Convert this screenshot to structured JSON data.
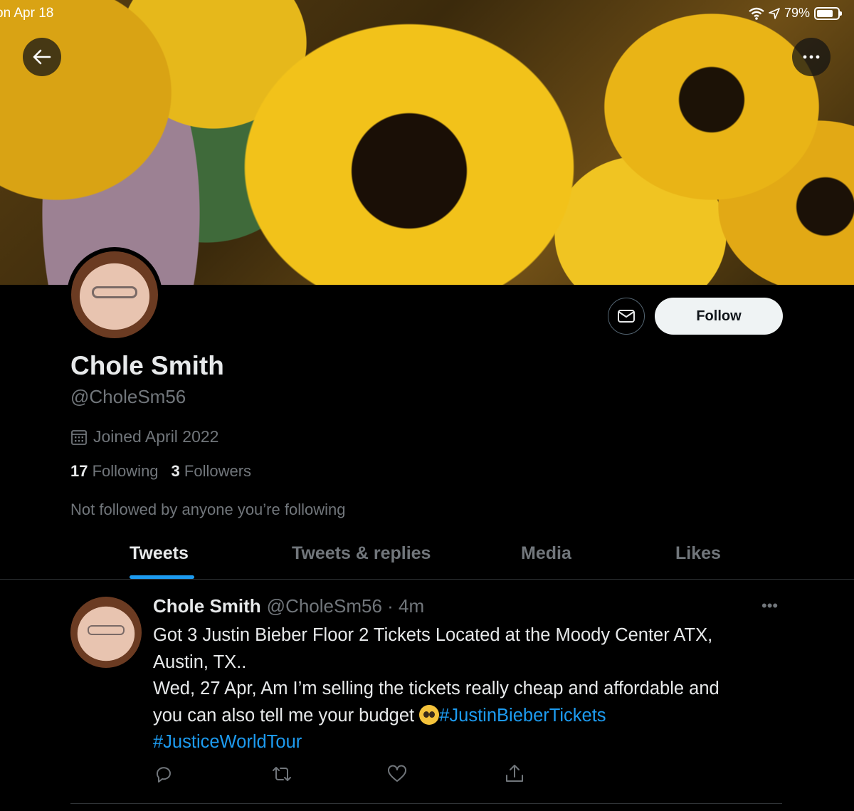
{
  "statusbar": {
    "date": "on Apr 18",
    "battery": "79%",
    "battery_level": 0.79
  },
  "profile": {
    "name": "Chole Smith",
    "handle": "@CholeSm56",
    "joined": "Joined April 2022",
    "following_count": "17",
    "following_label": "Following",
    "followers_count": "3",
    "followers_label": "Followers",
    "mutuals": "Not followed by anyone you’re following",
    "follow_label": "Follow"
  },
  "tabs": [
    {
      "label": "Tweets",
      "active": true
    },
    {
      "label": "Tweets & replies",
      "active": false
    },
    {
      "label": "Media",
      "active": false
    },
    {
      "label": "Likes",
      "active": false
    }
  ],
  "tweet": {
    "name": "Chole Smith",
    "meta": "@CholeSm56 · 4m",
    "line1": "Got 3 Justin Bieber Floor 2 Tickets Located at the Moody Center ATX,",
    "line2": "Austin, TX..",
    "line3": "Wed, 27 Apr, Am I’m selling the tickets really cheap and affordable and",
    "line4": "you can also tell me your budget",
    "emoji": "pleading-face-emoji",
    "hashtag1": "#JustinBieberTickets",
    "hashtag2": "#JusticeWorldTour",
    "more": "•••"
  },
  "icons": {
    "back": "arrow-left-icon",
    "more": "ellipsis-icon",
    "mail": "envelope-icon",
    "calendar": "calendar-icon",
    "reply": "reply-icon",
    "retweet": "retweet-icon",
    "like": "heart-icon",
    "share": "share-icon"
  },
  "colors": {
    "accent": "#1d9bf0",
    "muted": "#71767b",
    "text": "#e7e9ea",
    "background": "#000000"
  }
}
